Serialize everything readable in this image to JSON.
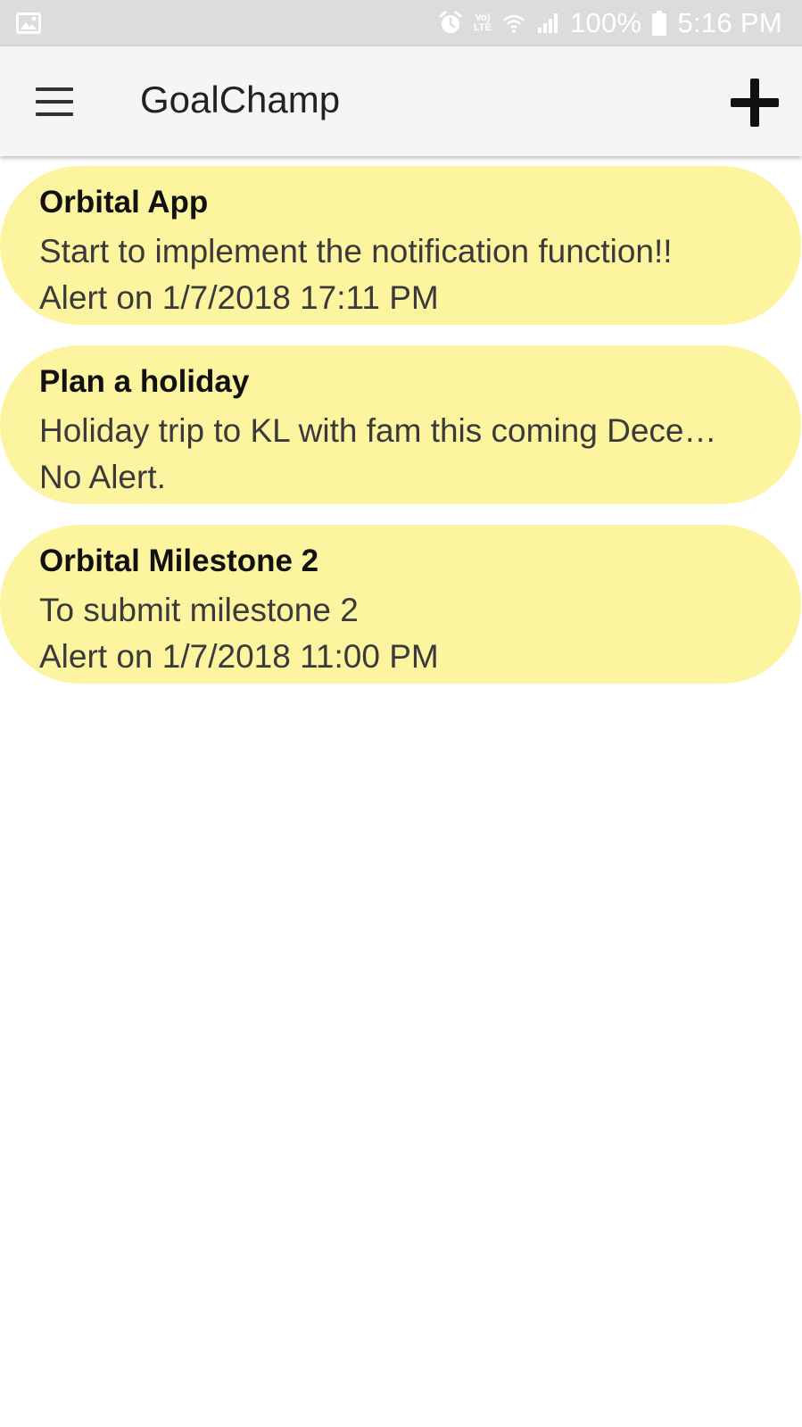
{
  "status_bar": {
    "battery": "100%",
    "time": "5:16 PM",
    "lte_top": "Vo)",
    "lte_bottom": "LTE",
    "icons": [
      "gallery-icon",
      "alarm-icon",
      "volte-icon",
      "wifi-icon",
      "signal-icon",
      "battery-icon"
    ]
  },
  "app_bar": {
    "title": "GoalChamp",
    "menu_icon": "hamburger-menu-icon",
    "add_icon": "plus-icon"
  },
  "goals": [
    {
      "title": "Orbital App",
      "description": "Start to implement the notification function!!",
      "alert": "Alert on 1/7/2018 17:11 PM"
    },
    {
      "title": "Plan a holiday",
      "description": "Holiday trip to KL with fam this coming Dece…",
      "alert": "No Alert."
    },
    {
      "title": "Orbital Milestone 2",
      "description": "To submit milestone 2",
      "alert": "Alert on 1/7/2018 11:00 PM"
    }
  ],
  "colors": {
    "card_background": "#fdf49f",
    "app_bar": "#f5f5f5",
    "status_bar": "#dcdcdc"
  }
}
